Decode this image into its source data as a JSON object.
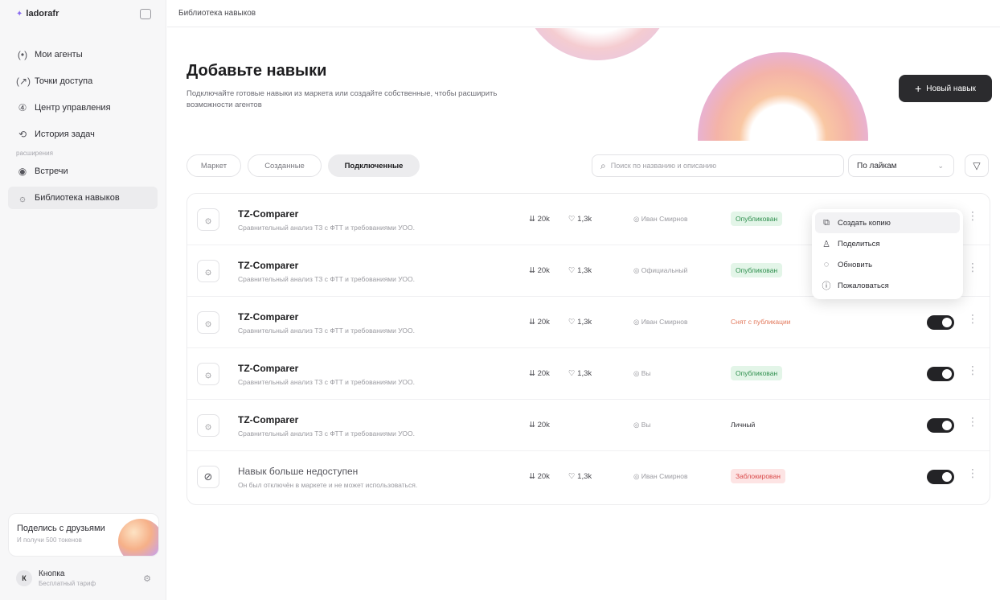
{
  "app": {
    "logo_text": "ladorafr",
    "breadcrumb": "Библиотека навыков"
  },
  "sidebar": {
    "items": [
      {
        "label": "Мои агенты",
        "icon": "agents-icon",
        "glyph": "(•)"
      },
      {
        "label": "Точки доступа",
        "icon": "access-point-icon",
        "glyph": "(↗)"
      },
      {
        "label": "Центр управления",
        "icon": "control-center-icon",
        "glyph": "④"
      },
      {
        "label": "История задач",
        "icon": "task-history-icon",
        "glyph": "⟲"
      }
    ],
    "section_label": "расширения",
    "ext_items": [
      {
        "label": "Встречи",
        "icon": "meetings-icon",
        "glyph": "◉"
      },
      {
        "label": "Библиотека навыков",
        "icon": "skills-library-icon",
        "glyph": "۞",
        "active": true
      }
    ],
    "share": {
      "title": "Поделись с друзьями",
      "subtitle": "И получи 500 токенов"
    },
    "user": {
      "initial": "К",
      "name": "Кнопка",
      "plan": "Бесплатный тариф"
    }
  },
  "hero": {
    "title": "Добавьте навыки",
    "subtitle": "Подключайте готовые навыки из маркета или создайте собственные, чтобы расширить возможности агентов",
    "new_button": "Новый навык"
  },
  "filters": {
    "tabs": [
      "Маркет",
      "Созданные",
      "Подключенные"
    ],
    "active_tab": "Подключенные",
    "search_placeholder": "Поиск по названию и описанию",
    "sort_value": "По лайкам"
  },
  "colors": {
    "status_green_bg": "#e3f5e8",
    "status_green_fg": "#2f8f4e",
    "status_orange_fg": "#e2775a",
    "status_red_bg": "#fde4e4",
    "status_red_fg": "#d94a4a",
    "status_plain_fg": "#2d2d33"
  },
  "skills": [
    {
      "name": "TZ-Comparer",
      "desc": "Сравнительный анализ ТЗ с ФТТ и требованиями УОО.",
      "downloads": "20k",
      "likes": "1,3k",
      "author": "Иван Смирнов",
      "status": "Опубликован",
      "status_type": "green",
      "toggle": false,
      "menu_open": true
    },
    {
      "name": "TZ-Comparer",
      "desc": "Сравнительный анализ ТЗ с ФТТ и требованиями УОО.",
      "downloads": "20k",
      "likes": "1,3k",
      "author": "Официальный",
      "status": "Опубликован",
      "status_type": "green",
      "toggle": false
    },
    {
      "name": "TZ-Comparer",
      "desc": "Сравнительный анализ ТЗ с ФТТ и требованиями УОО.",
      "downloads": "20k",
      "likes": "1,3k",
      "author": "Иван Смирнов",
      "status": "Снят с публикации",
      "status_type": "orange",
      "toggle": true
    },
    {
      "name": "TZ-Comparer",
      "desc": "Сравнительный анализ ТЗ с ФТТ и требованиями УОО.",
      "downloads": "20k",
      "likes": "1,3k",
      "author": "Вы",
      "status": "Опубликован",
      "status_type": "green",
      "toggle": true
    },
    {
      "name": "TZ-Comparer",
      "desc": "Сравнительный анализ ТЗ с ФТТ и требованиями УОО.",
      "downloads": "20k",
      "likes": "",
      "author": "Вы",
      "status": "Личный",
      "status_type": "plain",
      "toggle": true
    },
    {
      "name": "Навык больше недоступен",
      "desc": "Он был отключён в маркете и не может использоваться.",
      "downloads": "20k",
      "likes": "1,3k",
      "author": "Иван Смирнов",
      "status": "Заблокирован",
      "status_type": "red",
      "toggle": true,
      "disabled": true
    }
  ],
  "context_menu": [
    {
      "label": "Создать копию",
      "icon": "copy-icon",
      "glyph": "⧉"
    },
    {
      "label": "Поделиться",
      "icon": "share-icon",
      "glyph": "♙"
    },
    {
      "label": "Обновить",
      "icon": "refresh-icon",
      "glyph": "◌"
    },
    {
      "label": "Пожаловаться",
      "icon": "report-icon",
      "glyph": "ⓘ"
    }
  ]
}
